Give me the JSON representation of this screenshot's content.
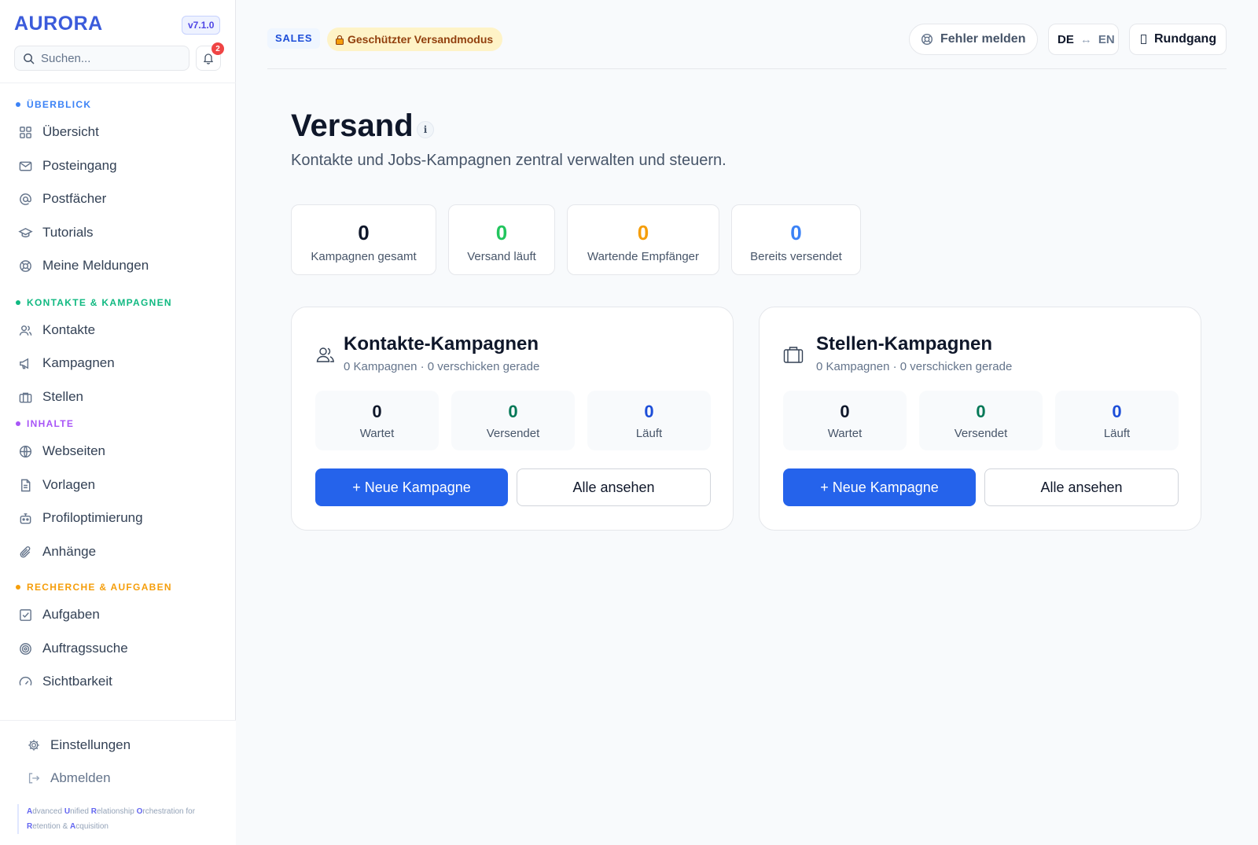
{
  "app": {
    "logo": "AURORA",
    "version": "v7.1.0",
    "search_placeholder": "Suchen...",
    "notification_count": "2"
  },
  "sidebar": {
    "sections": [
      {
        "label": "ÜBERBLICK",
        "color": "#3b82f6"
      },
      {
        "label": "KONTAKTE & KAMPAGNEN",
        "color": "#10b981"
      },
      {
        "label": "INHALTE",
        "color": "#a855f7"
      },
      {
        "label": "RECHERCHE & AUFGABEN",
        "color": "#f59e0b"
      }
    ],
    "items": [
      {
        "label": "Übersicht",
        "icon": "grid-icon"
      },
      {
        "label": "Posteingang",
        "icon": "mail-icon"
      },
      {
        "label": "Postfächer",
        "icon": "at-icon"
      },
      {
        "label": "Tutorials",
        "icon": "graduation-cap-icon"
      },
      {
        "label": "Meine Meldungen",
        "icon": "lifebuoy-icon"
      },
      {
        "label": "Kontakte",
        "icon": "users-icon"
      },
      {
        "label": "Kampagnen",
        "icon": "megaphone-icon"
      },
      {
        "label": "Stellen",
        "icon": "briefcase-icon"
      },
      {
        "label": "Webseiten",
        "icon": "globe-icon"
      },
      {
        "label": "Vorlagen",
        "icon": "document-icon"
      },
      {
        "label": "Profiloptimierung",
        "icon": "robot-icon"
      },
      {
        "label": "Anhänge",
        "icon": "paperclip-icon"
      },
      {
        "label": "Aufgaben",
        "icon": "checkbox-icon"
      },
      {
        "label": "Auftragssuche",
        "icon": "target-icon"
      },
      {
        "label": "Sichtbarkeit",
        "icon": "gauge-icon"
      }
    ],
    "footer": {
      "settings": "Einstellungen",
      "logout": "Abmelden",
      "acronym_words": [
        "Advanced",
        "Unified",
        "Relationship",
        "Orchestration for",
        "Retention &",
        "Acquisition"
      ]
    }
  },
  "header": {
    "tag_sales": "SALES",
    "tag_secure": "Geschützter Versandmodus",
    "report_button": "Fehler melden",
    "lang_de": "DE",
    "lang_arrow": "↔",
    "lang_en": "EN",
    "tour_button": "Rundgang"
  },
  "main": {
    "title": "Versand",
    "info": "i",
    "subtitle": "Kontakte und Jobs-Kampagnen zentral verwalten und steuern.",
    "stats": [
      {
        "value": "0",
        "label": "Kampagnen gesamt",
        "color": "#0f172a"
      },
      {
        "value": "0",
        "label": "Versand läuft",
        "color": "#22c55e"
      },
      {
        "value": "0",
        "label": "Wartende Empfänger",
        "color": "#f59e0b"
      },
      {
        "value": "0",
        "label": "Bereits versendet",
        "color": "#3b82f6"
      }
    ],
    "cards": [
      {
        "title": "Kontakte-Kampagnen",
        "subtitle": "0 Kampagnen · 0 verschicken gerade",
        "icon": "users-icon",
        "metrics": [
          {
            "value": "0",
            "label": "Wartet",
            "color": "#0f172a"
          },
          {
            "value": "0",
            "label": "Versendet",
            "color": "#047857"
          },
          {
            "value": "0",
            "label": "Läuft",
            "color": "#1d4ed8"
          }
        ],
        "primary": "+ Neue Kampagne",
        "secondary": "Alle ansehen"
      },
      {
        "title": "Stellen-Kampagnen",
        "subtitle": "0 Kampagnen · 0 verschicken gerade",
        "icon": "briefcase-icon",
        "metrics": [
          {
            "value": "0",
            "label": "Wartet",
            "color": "#0f172a"
          },
          {
            "value": "0",
            "label": "Versendet",
            "color": "#047857"
          },
          {
            "value": "0",
            "label": "Läuft",
            "color": "#1d4ed8"
          }
        ],
        "primary": "+ Neue Kampagne",
        "secondary": "Alle ansehen"
      }
    ]
  }
}
